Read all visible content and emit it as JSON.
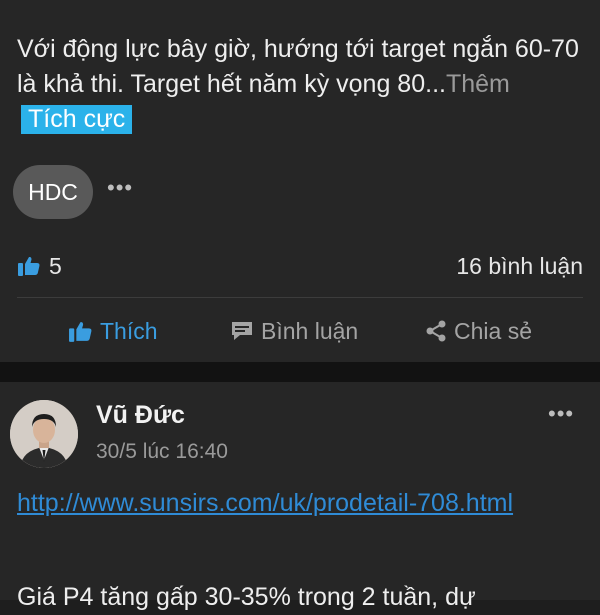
{
  "post1": {
    "text": "Với động lực bây giờ, hướng tới target ngắn 60-70 là khả thi. Target hết năm kỳ vọng 80...",
    "more_label": "Thêm",
    "sentiment_tag": "Tích cực",
    "stock_tag": "HDC",
    "options_label": "•••",
    "like_count": "5",
    "comment_count": "16 bình luận",
    "actions": {
      "like": "Thích",
      "comment": "Bình luận",
      "share": "Chia sẻ"
    }
  },
  "post2": {
    "author": "Vũ Đức",
    "timestamp": "30/5 lúc 16:40",
    "options_label": "•••",
    "link": "http://www.sunsirs.com/uk/prodetail-708.html",
    "text": "Giá P4 tăng gấp 30-35% trong 2 tuần, dự"
  },
  "colors": {
    "background": "#262626",
    "accent": "#3a9de0",
    "tag": "#2bb2ea",
    "chip": "#595959"
  },
  "icons": [
    "thumbs-up-icon",
    "comment-icon",
    "share-icon",
    "more-options-icon"
  ]
}
